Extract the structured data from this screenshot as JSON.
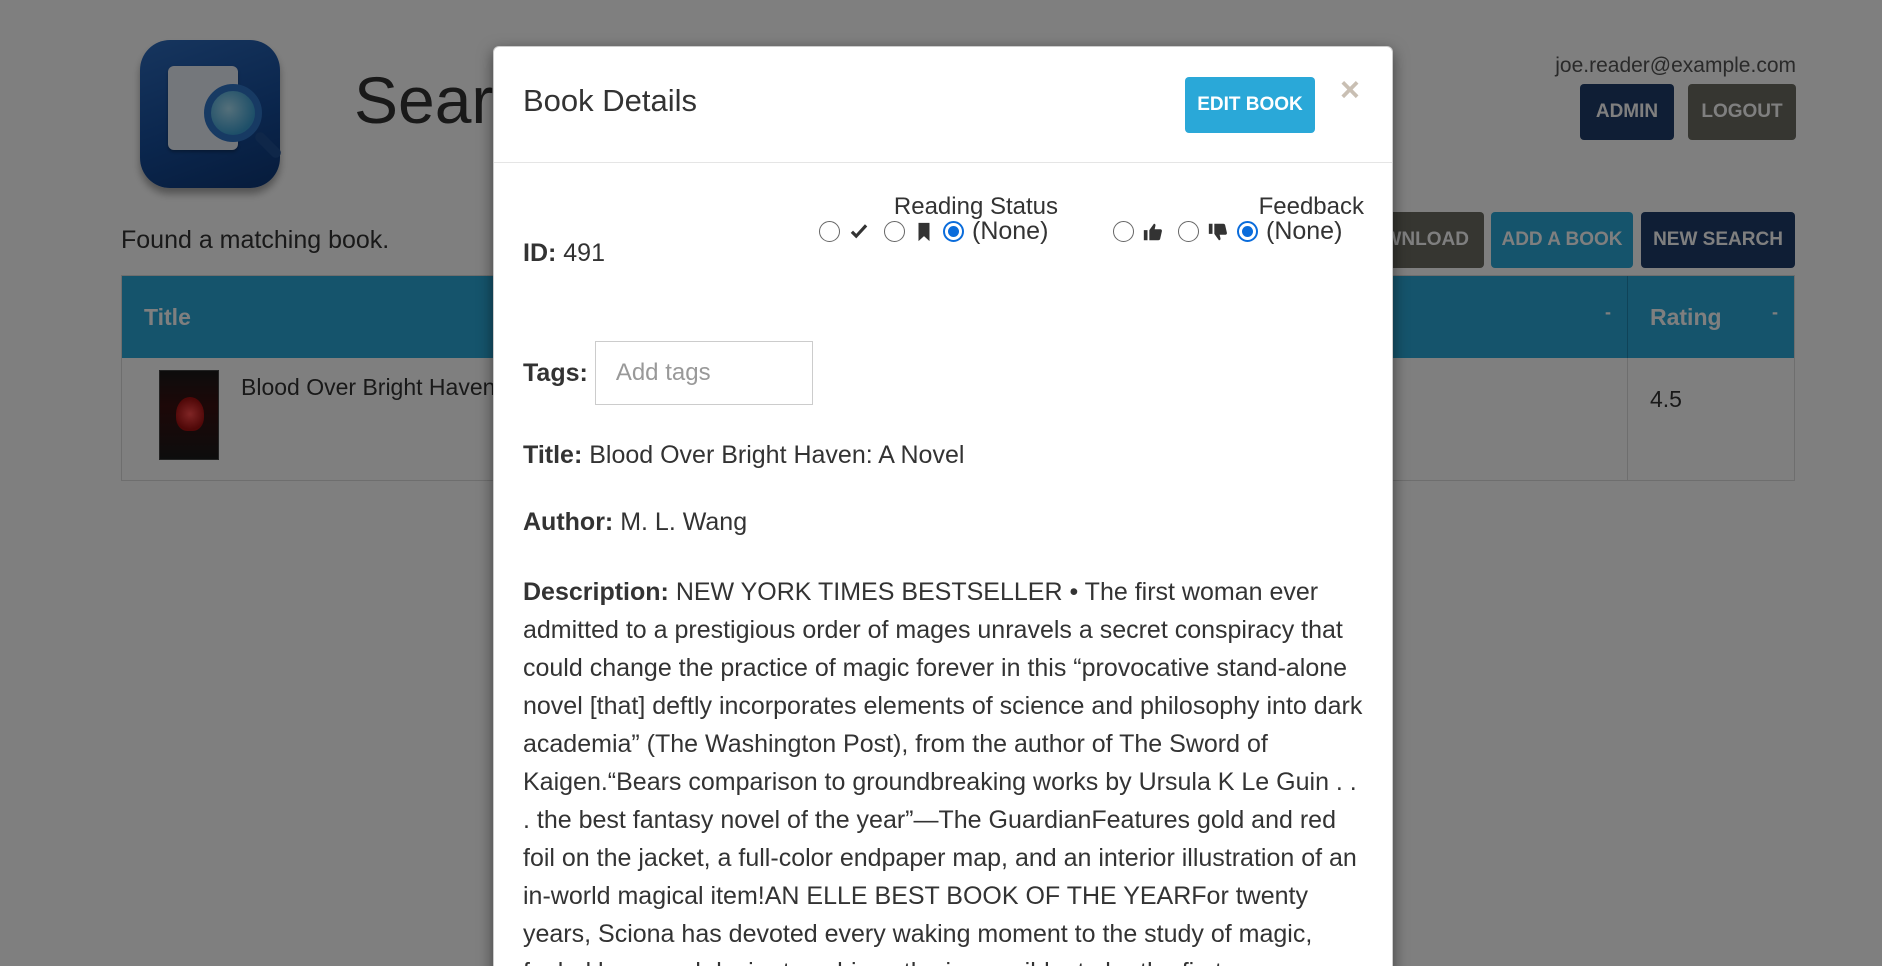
{
  "app": {
    "page_title": "Search",
    "user_email": "joe.reader@example.com",
    "admin_label": "ADMIN",
    "logout_label": "LOGOUT",
    "found_message": "Found a matching book.",
    "download_label": "DOWNLOAD",
    "add_book_label": "ADD A BOOK",
    "new_search_label": "NEW SEARCH"
  },
  "table": {
    "columns": [
      {
        "label": "Title",
        "sort": "-"
      },
      {
        "label": "Rating",
        "sort": "-"
      }
    ],
    "rows": [
      {
        "title": "Blood Over Bright Haven: A Novel",
        "rating": "4.5"
      }
    ]
  },
  "modal": {
    "title": "Book Details",
    "edit_label": "EDIT BOOK",
    "close_symbol": "×",
    "id_label": "ID:",
    "id_value": "491",
    "reading_status": {
      "label": "Reading Status",
      "options": [
        {
          "icon": "checkmark-icon",
          "checked": false
        },
        {
          "icon": "bookmark-icon",
          "checked": false
        },
        {
          "text": "(None)",
          "checked": true
        }
      ]
    },
    "feedback": {
      "label": "Feedback",
      "options": [
        {
          "icon": "thumbs-up-icon",
          "checked": false
        },
        {
          "icon": "thumbs-down-icon",
          "checked": false
        },
        {
          "text": "(None)",
          "checked": true
        }
      ]
    },
    "tags_label": "Tags:",
    "tags_placeholder": "Add tags",
    "title_label": "Title:",
    "title_value": "Blood Over Bright Haven: A Novel",
    "author_label": "Author:",
    "author_value": "M. L. Wang",
    "description_label": "Description:",
    "description_value": "NEW YORK TIMES BESTSELLER • The first woman ever admitted to a prestigious order of mages unravels a secret conspiracy that could change the practice of magic forever in this “provocative stand-alone novel [that] deftly incorporates elements of science and philosophy into dark academia” (The Washington Post), from the author of The Sword of Kaigen.“Bears comparison to groundbreaking works by Ursula K Le Guin . . . the best fantasy novel of the year”—The GuardianFeatures gold and red foil on the jacket, a full-color endpaper map, and an interior illustration of an in-world magical item!AN ELLE BEST BOOK OF THE YEARFor twenty years, Sciona has devoted every waking moment to the study of magic, fueled by a mad desire to achieve the impossible: to be the first woman ever"
  },
  "colors": {
    "primary": "#2aa8d8",
    "navy": "#1f3d6a",
    "gray_button": "#6c6c63",
    "radio_checked": "#0a6cdb"
  }
}
